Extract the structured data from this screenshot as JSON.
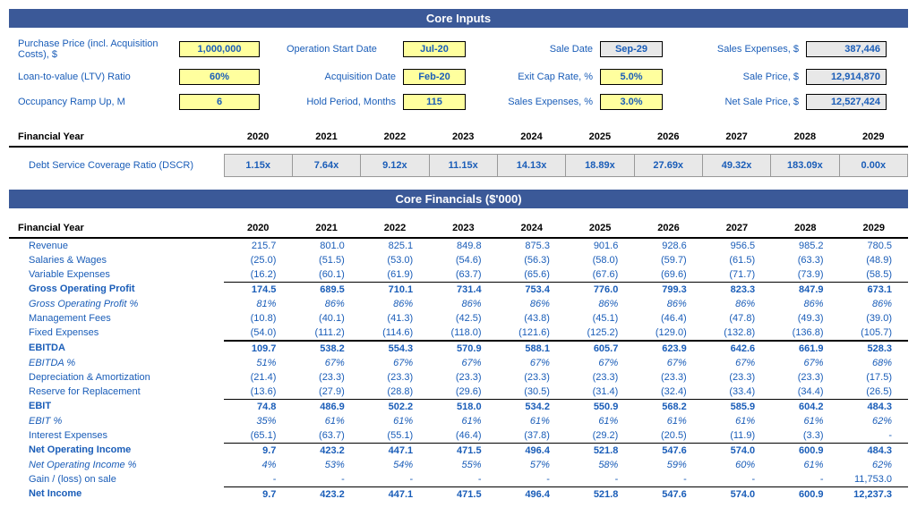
{
  "core_inputs_title": "Core Inputs",
  "core_financials_title": "Core Financials ($'000)",
  "inputs": {
    "purchase_price_label": "Purchase Price (incl. Acquisition Costs), $",
    "purchase_price": "1,000,000",
    "operation_start_label": "Operation Start Date",
    "operation_start": "Jul-20",
    "sale_date_label": "Sale Date",
    "sale_date": "Sep-29",
    "sales_expenses_amt_label": "Sales Expenses, $",
    "sales_expenses_amt": "387,446",
    "ltv_label": "Loan-to-value (LTV) Ratio",
    "ltv": "60%",
    "acq_date_label": "Acquisition Date",
    "acq_date": "Feb-20",
    "exit_cap_label": "Exit Cap Rate, %",
    "exit_cap": "5.0%",
    "sale_price_label": "Sale Price, $",
    "sale_price": "12,914,870",
    "occ_ramp_label": "Occupancy Ramp Up, M",
    "occ_ramp": "6",
    "hold_period_label": "Hold Period, Months",
    "hold_period": "115",
    "sales_exp_pct_label": "Sales Expenses, %",
    "sales_exp_pct": "3.0%",
    "net_sale_label": "Net Sale Price, $",
    "net_sale": "12,527,424"
  },
  "fy_label": "Financial Year",
  "years": [
    "2020",
    "2021",
    "2022",
    "2023",
    "2024",
    "2025",
    "2026",
    "2027",
    "2028",
    "2029"
  ],
  "dscr_label": "Debt Service Coverage Ratio (DSCR)",
  "dscr": [
    "1.15x",
    "7.64x",
    "9.12x",
    "11.15x",
    "14.13x",
    "18.89x",
    "27.69x",
    "49.32x",
    "183.09x",
    "0.00x"
  ],
  "rows": {
    "revenue": {
      "label": "Revenue",
      "v": [
        "215.7",
        "801.0",
        "825.1",
        "849.8",
        "875.3",
        "901.6",
        "928.6",
        "956.5",
        "985.2",
        "780.5"
      ]
    },
    "salaries": {
      "label": "Salaries & Wages",
      "v": [
        "(25.0)",
        "(51.5)",
        "(53.0)",
        "(54.6)",
        "(56.3)",
        "(58.0)",
        "(59.7)",
        "(61.5)",
        "(63.3)",
        "(48.9)"
      ]
    },
    "varexp": {
      "label": "Variable Expenses",
      "v": [
        "(16.2)",
        "(60.1)",
        "(61.9)",
        "(63.7)",
        "(65.6)",
        "(67.6)",
        "(69.6)",
        "(71.7)",
        "(73.9)",
        "(58.5)"
      ]
    },
    "gop": {
      "label": "Gross Operating Profit",
      "v": [
        "174.5",
        "689.5",
        "710.1",
        "731.4",
        "753.4",
        "776.0",
        "799.3",
        "823.3",
        "847.9",
        "673.1"
      ]
    },
    "gop_pct": {
      "label": "Gross Operating Profit %",
      "v": [
        "81%",
        "86%",
        "86%",
        "86%",
        "86%",
        "86%",
        "86%",
        "86%",
        "86%",
        "86%"
      ]
    },
    "mgmt": {
      "label": "Management Fees",
      "v": [
        "(10.8)",
        "(40.1)",
        "(41.3)",
        "(42.5)",
        "(43.8)",
        "(45.1)",
        "(46.4)",
        "(47.8)",
        "(49.3)",
        "(39.0)"
      ]
    },
    "fixed": {
      "label": "Fixed Expenses",
      "v": [
        "(54.0)",
        "(111.2)",
        "(114.6)",
        "(118.0)",
        "(121.6)",
        "(125.2)",
        "(129.0)",
        "(132.8)",
        "(136.8)",
        "(105.7)"
      ]
    },
    "ebitda": {
      "label": "EBITDA",
      "v": [
        "109.7",
        "538.2",
        "554.3",
        "570.9",
        "588.1",
        "605.7",
        "623.9",
        "642.6",
        "661.9",
        "528.3"
      ]
    },
    "ebitda_pct": {
      "label": "EBITDA %",
      "v": [
        "51%",
        "67%",
        "67%",
        "67%",
        "67%",
        "67%",
        "67%",
        "67%",
        "67%",
        "68%"
      ]
    },
    "da": {
      "label": "Depreciation & Amortization",
      "v": [
        "(21.4)",
        "(23.3)",
        "(23.3)",
        "(23.3)",
        "(23.3)",
        "(23.3)",
        "(23.3)",
        "(23.3)",
        "(23.3)",
        "(17.5)"
      ]
    },
    "reserve": {
      "label": "Reserve for Replacement",
      "v": [
        "(13.6)",
        "(27.9)",
        "(28.8)",
        "(29.6)",
        "(30.5)",
        "(31.4)",
        "(32.4)",
        "(33.4)",
        "(34.4)",
        "(26.5)"
      ]
    },
    "ebit": {
      "label": "EBIT",
      "v": [
        "74.8",
        "486.9",
        "502.2",
        "518.0",
        "534.2",
        "550.9",
        "568.2",
        "585.9",
        "604.2",
        "484.3"
      ]
    },
    "ebit_pct": {
      "label": "EBIT %",
      "v": [
        "35%",
        "61%",
        "61%",
        "61%",
        "61%",
        "61%",
        "61%",
        "61%",
        "61%",
        "62%"
      ]
    },
    "interest": {
      "label": "Interest Expenses",
      "v": [
        "(65.1)",
        "(63.7)",
        "(55.1)",
        "(46.4)",
        "(37.8)",
        "(29.2)",
        "(20.5)",
        "(11.9)",
        "(3.3)",
        "-"
      ]
    },
    "noi": {
      "label": "Net Operating Income",
      "v": [
        "9.7",
        "423.2",
        "447.1",
        "471.5",
        "496.4",
        "521.8",
        "547.6",
        "574.0",
        "600.9",
        "484.3"
      ]
    },
    "noi_pct": {
      "label": "Net Operating Income %",
      "v": [
        "4%",
        "53%",
        "54%",
        "55%",
        "57%",
        "58%",
        "59%",
        "60%",
        "61%",
        "62%"
      ]
    },
    "gain": {
      "label": "Gain / (loss) on sale",
      "v": [
        "-",
        "-",
        "-",
        "-",
        "-",
        "-",
        "-",
        "-",
        "-",
        "11,753.0"
      ]
    },
    "netincome": {
      "label": "Net Income",
      "v": [
        "9.7",
        "423.2",
        "447.1",
        "471.5",
        "496.4",
        "521.8",
        "547.6",
        "574.0",
        "600.9",
        "12,237.3"
      ]
    }
  }
}
